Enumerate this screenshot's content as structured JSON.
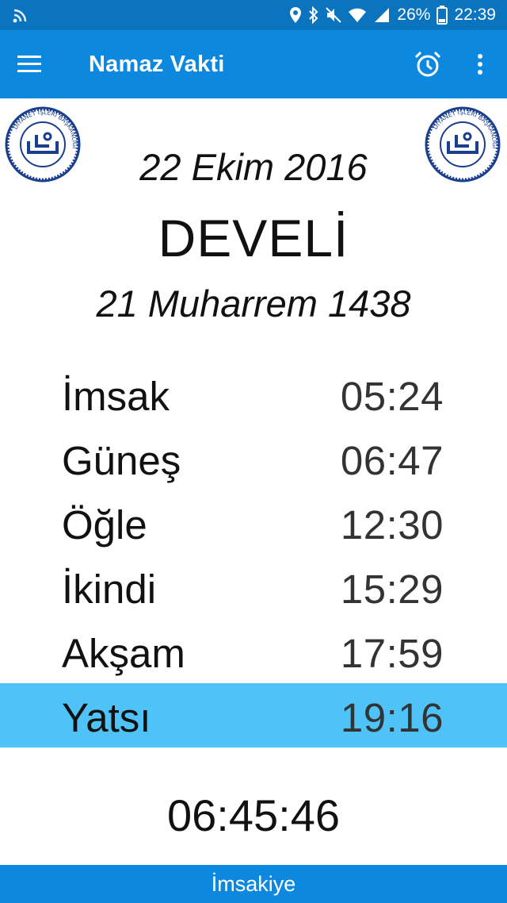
{
  "status_bar": {
    "battery": "26%",
    "time": "22:39"
  },
  "app_bar": {
    "title": "Namaz Vakti"
  },
  "logo": {
    "text": "DİYANET İŞLERİ BAŞKANLIĞI"
  },
  "header": {
    "gregorian_date": "22 Ekim 2016",
    "city": "DEVELİ",
    "hijri_date": "21 Muharrem 1438"
  },
  "prayer_times": [
    {
      "name": "İmsak",
      "time": "05:24"
    },
    {
      "name": "Güneş",
      "time": "06:47"
    },
    {
      "name": "Öğle",
      "time": "12:30"
    },
    {
      "name": "İkindi",
      "time": "15:29"
    },
    {
      "name": "Akşam",
      "time": "17:59"
    },
    {
      "name": "Yatsı",
      "time": "19:16"
    }
  ],
  "active_prayer_index": 5,
  "countdown": "06:45:46",
  "bottom_bar": {
    "label": "İmsakiye"
  },
  "colors": {
    "status_bar": "#0a74bf",
    "app_bar": "#0d88df",
    "highlight": "#4fc3f7",
    "logo_blue": "#1a3f8f"
  }
}
